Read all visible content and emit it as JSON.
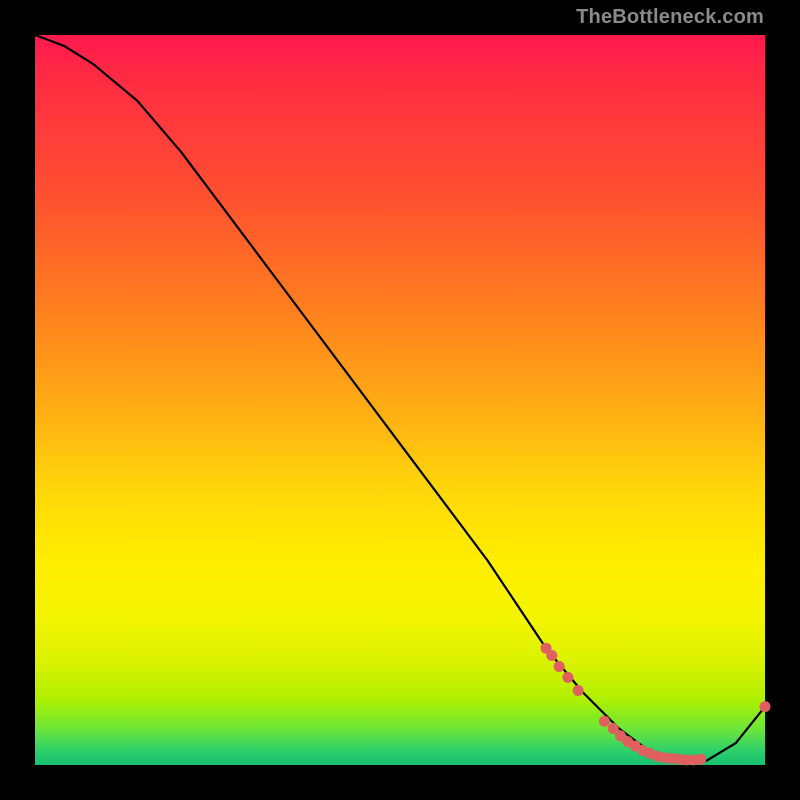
{
  "watermark": "TheBottleneck.com",
  "chart_data": {
    "type": "line",
    "title": "",
    "xlabel": "",
    "ylabel": "",
    "xlim": [
      0,
      100
    ],
    "ylim": [
      0,
      100
    ],
    "grid": false,
    "legend": false,
    "series": [
      {
        "name": "bottleneck-curve",
        "x": [
          0,
          4,
          8,
          14,
          20,
          26,
          32,
          38,
          44,
          50,
          56,
          62,
          66,
          70,
          75,
          80,
          84,
          88,
          92,
          96,
          100
        ],
        "y": [
          100,
          98.5,
          96,
          91,
          84,
          76,
          68,
          60,
          52,
          44,
          36,
          28,
          22,
          16,
          10,
          5,
          2,
          0.8,
          0.6,
          3,
          8
        ]
      }
    ],
    "points": [
      {
        "name": "marker",
        "x": 70.0,
        "y": 16.0
      },
      {
        "name": "marker",
        "x": 70.8,
        "y": 15.0
      },
      {
        "name": "marker",
        "x": 71.8,
        "y": 13.5
      },
      {
        "name": "marker",
        "x": 73.0,
        "y": 12.0
      },
      {
        "name": "marker",
        "x": 74.4,
        "y": 10.2
      },
      {
        "name": "marker",
        "x": 78.0,
        "y": 6.0
      },
      {
        "name": "marker",
        "x": 79.2,
        "y": 5.0
      },
      {
        "name": "marker",
        "x": 80.2,
        "y": 4.0
      },
      {
        "name": "marker",
        "x": 81.2,
        "y": 3.2
      },
      {
        "name": "marker",
        "x": 82.2,
        "y": 2.6
      },
      {
        "name": "marker",
        "x": 83.2,
        "y": 2.0
      },
      {
        "name": "marker",
        "x": 84.2,
        "y": 1.6
      },
      {
        "name": "marker",
        "x": 85.2,
        "y": 1.2
      },
      {
        "name": "marker",
        "x": 86.2,
        "y": 1.0
      },
      {
        "name": "marker",
        "x": 87.2,
        "y": 0.9
      },
      {
        "name": "marker",
        "x": 88.2,
        "y": 0.8
      },
      {
        "name": "marker",
        "x": 89.2,
        "y": 0.7
      },
      {
        "name": "marker",
        "x": 90.2,
        "y": 0.7
      },
      {
        "name": "marker",
        "x": 91.2,
        "y": 0.8
      },
      {
        "name": "marker",
        "x": 100.0,
        "y": 8.0
      }
    ],
    "colors": {
      "curve": "#000000",
      "dot": "#e06060",
      "gradient_top": "#ff1a4d",
      "gradient_bottom": "#17c070",
      "background": "#000000"
    }
  }
}
